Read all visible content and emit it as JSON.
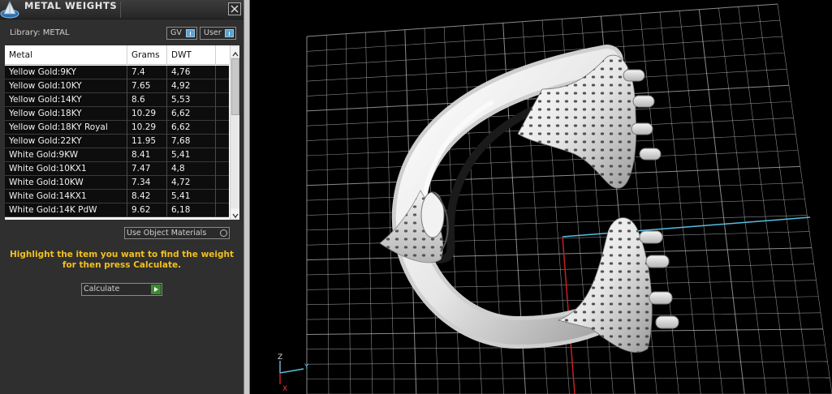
{
  "panel": {
    "title": "METAL WEIGHTS",
    "library_label": "Library: METAL",
    "gv_toggle": "GV",
    "user_toggle": "User",
    "use_object_materials": "Use Object Materials",
    "instruction_line1": "Highlight the item you want to find the weight",
    "instruction_line2": "for then press Calculate.",
    "calculate_label": "Calculate"
  },
  "table": {
    "headers": {
      "metal": "Metal",
      "grams": "Grams",
      "dwt": "DWT"
    },
    "rows": [
      {
        "metal": "Yellow Gold:9KY",
        "grams": "7.4",
        "dwt": "4,76"
      },
      {
        "metal": "Yellow Gold:10KY",
        "grams": "7.65",
        "dwt": "4,92"
      },
      {
        "metal": "Yellow Gold:14KY",
        "grams": "8.6",
        "dwt": "5,53"
      },
      {
        "metal": "Yellow Gold:18KY",
        "grams": "10.29",
        "dwt": "6,62"
      },
      {
        "metal": "Yellow Gold:18KY Royal",
        "grams": "10.29",
        "dwt": "6,62"
      },
      {
        "metal": "Yellow Gold:22KY",
        "grams": "11.95",
        "dwt": "7,68"
      },
      {
        "metal": "White Gold:9KW",
        "grams": "8.41",
        "dwt": "5,41"
      },
      {
        "metal": "White Gold:10KX1",
        "grams": "7.47",
        "dwt": "4,8"
      },
      {
        "metal": "White Gold:10KW",
        "grams": "7.34",
        "dwt": "4,72"
      },
      {
        "metal": "White Gold:14KX1",
        "grams": "8.42",
        "dwt": "5,41"
      },
      {
        "metal": "White Gold:14K PdW",
        "grams": "9.62",
        "dwt": "6,18"
      }
    ]
  },
  "viewport": {
    "axis_z": "Z",
    "axis_y": "Y",
    "axis_x": "X",
    "colors": {
      "axis_z": "#7fa7c9",
      "axis_y": "#55c0e0",
      "axis_x": "#c82020",
      "grid": "#b8b8b8"
    }
  },
  "icons": [
    "app-logo-icon",
    "close-icon",
    "toggle-knob-icon",
    "radio-icon",
    "play-arrow-icon",
    "scroll-up-icon",
    "scroll-down-icon"
  ]
}
